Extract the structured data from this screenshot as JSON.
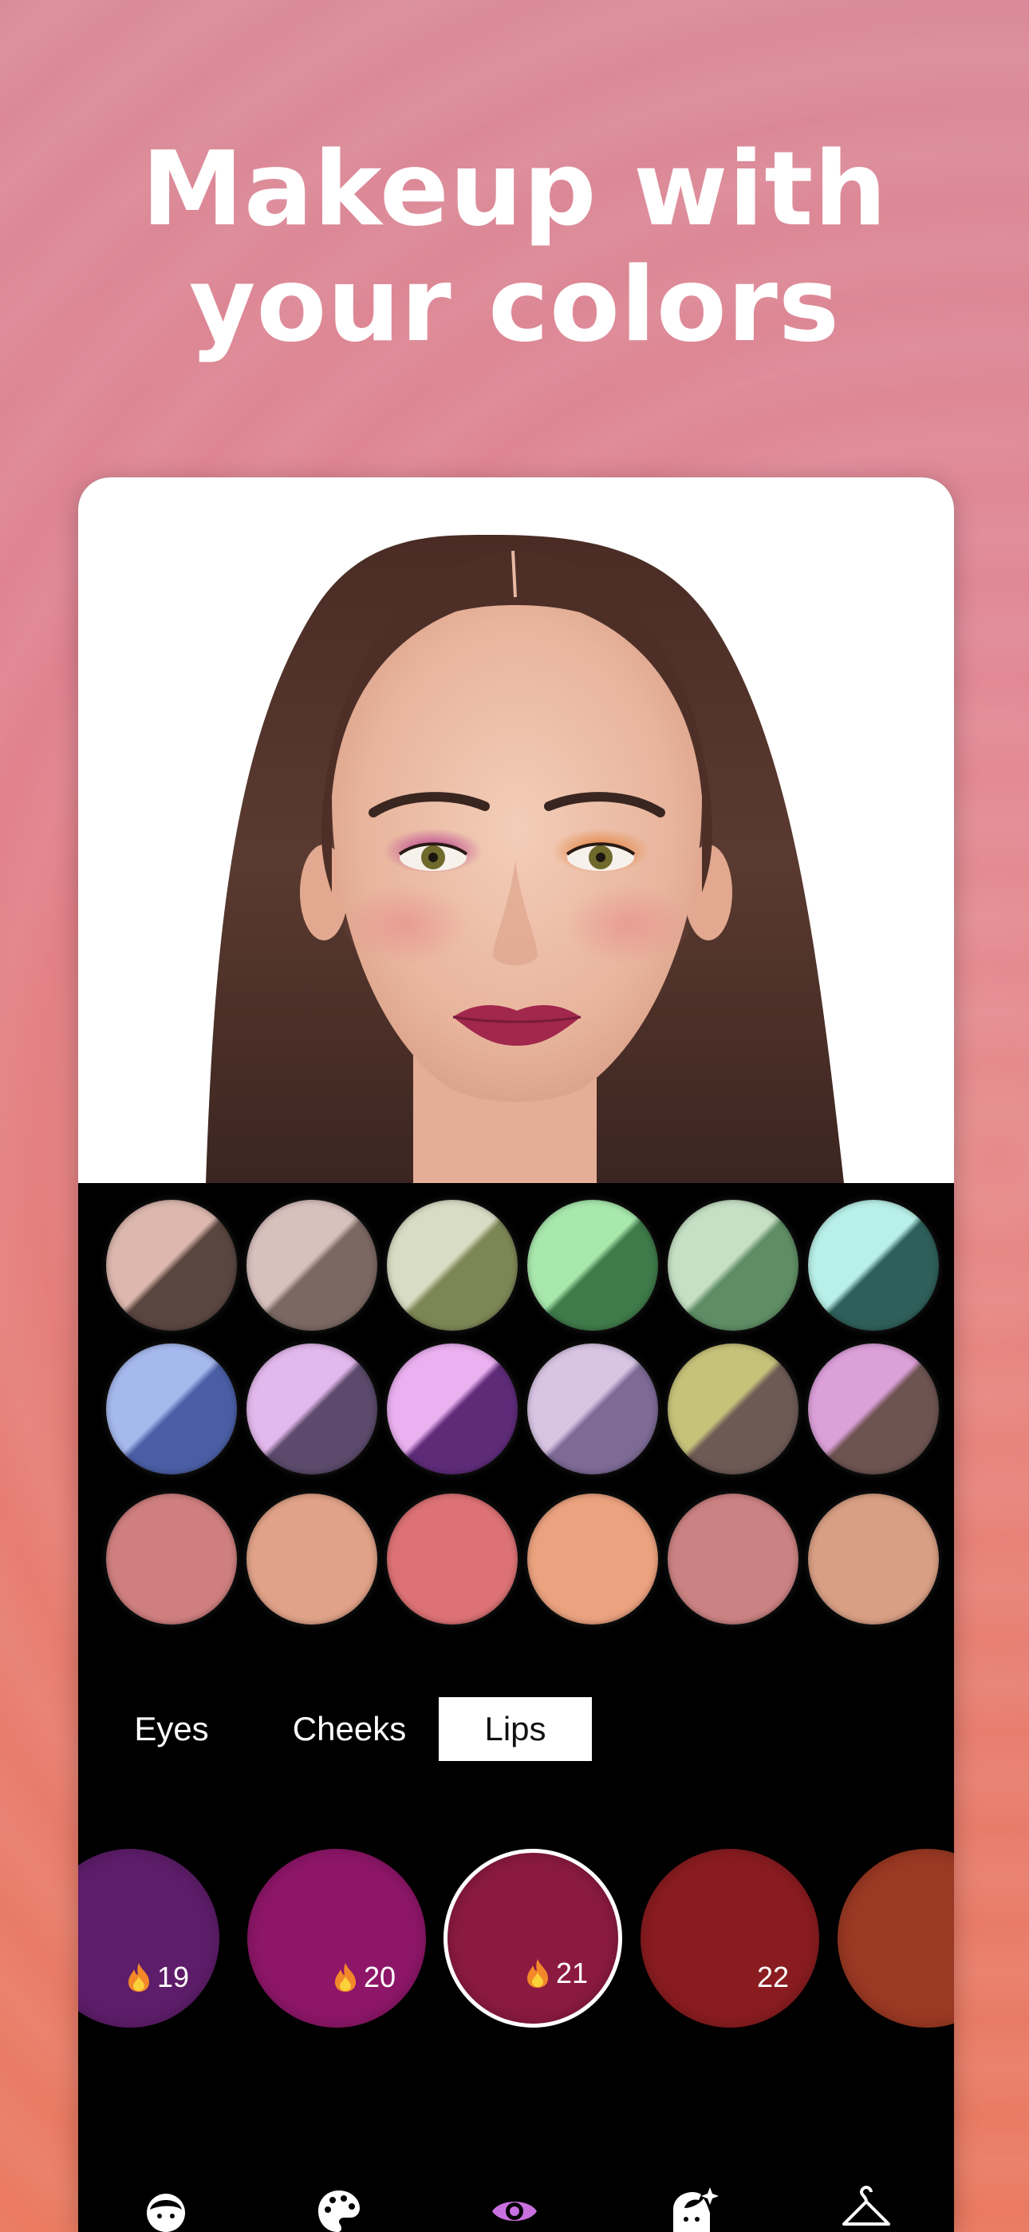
{
  "headline": {
    "line1": "Makeup with",
    "line2": "your colors"
  },
  "photo": {
    "subject": "model-face"
  },
  "palette": {
    "rows": [
      [
        {
          "top": "#dbb7ad",
          "bottom": "#5a4640"
        },
        {
          "top": "#d8c0bd",
          "bottom": "#7c6862"
        },
        {
          "top": "#d8dcc4",
          "bottom": "#7d8756"
        },
        {
          "top": "#a8e8ad",
          "bottom": "#3f7a4a"
        },
        {
          "top": "#c5e0c4",
          "bottom": "#5f8e65"
        },
        {
          "top": "#b8efe8",
          "bottom": "#2f5f5a"
        }
      ],
      [
        {
          "top": "#a6b9ee",
          "bottom": "#4b5ea5"
        },
        {
          "top": "#e3b8ec",
          "bottom": "#5b4a6b"
        },
        {
          "top": "#eab0f0",
          "bottom": "#5e2b79"
        },
        {
          "top": "#d8c5e4",
          "bottom": "#7d6a95"
        },
        {
          "top": "#c7c27a",
          "bottom": "#6d5a55"
        },
        {
          "top": "#dca0d9",
          "bottom": "#6d5450"
        }
      ],
      [
        {
          "top": "#cf7f7f",
          "bottom": "#cf7f7f"
        },
        {
          "top": "#e0a288",
          "bottom": "#e0a288"
        },
        {
          "top": "#dc7275",
          "bottom": "#dc7275"
        },
        {
          "top": "#eba27f",
          "bottom": "#eba27f"
        },
        {
          "top": "#cb8282",
          "bottom": "#cb8282"
        },
        {
          "top": "#d89f84",
          "bottom": "#d89f84"
        }
      ]
    ]
  },
  "tabs": [
    {
      "label": "Eyes",
      "active": false
    },
    {
      "label": "Cheeks",
      "active": false
    },
    {
      "label": "Lips",
      "active": true
    }
  ],
  "shades": [
    {
      "number": "19",
      "color": "#5e1d6a",
      "hot": true
    },
    {
      "number": "20",
      "color": "#8e1669",
      "hot": true
    },
    {
      "number": "21",
      "color": "#8b1a40",
      "hot": true,
      "selected": true
    },
    {
      "number": "22",
      "color": "#8a1c20",
      "hot": false
    },
    {
      "number": "",
      "color": "#9b3924",
      "hot": false
    }
  ],
  "nav": [
    {
      "icon": "face-icon",
      "active": false
    },
    {
      "icon": "palette-icon",
      "active": false
    },
    {
      "icon": "eye-icon",
      "active": true
    },
    {
      "icon": "face-sparkle-icon",
      "active": false
    },
    {
      "icon": "hanger-icon",
      "active": false
    }
  ],
  "colors": {
    "accent": "#c870e0",
    "nav_icon": "#ffffff",
    "card_bg": "#000000"
  }
}
